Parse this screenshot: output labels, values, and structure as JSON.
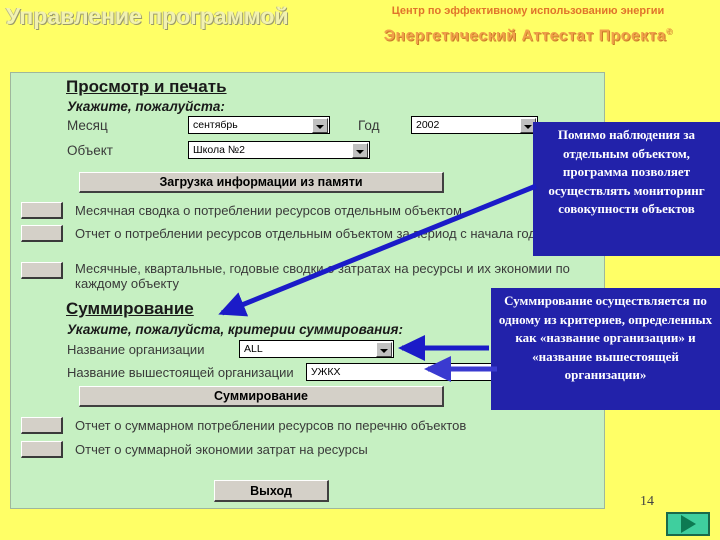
{
  "header": {
    "slide_title": "Управление программой",
    "subtitle": "Центр по эффективному использованию энергии",
    "main_title": "Энергетический Аттестат Проекта",
    "copyright_mark": "©"
  },
  "view_section": {
    "title": "Просмотр и печать",
    "instruction": "Укажите, пожалуйста:",
    "month_label": "Месяц",
    "month_value": "сентябрь",
    "year_label": "Год",
    "year_value": "2002",
    "object_label": "Объект",
    "object_value": "Школа №2",
    "load_button": "Загрузка информации из памяти",
    "reports": [
      "Месячная сводка о потреблении ресурсов отдельным объектом",
      "Отчет о потреблении ресурсов отдельным объектом за период с начала года",
      "Месячные, квартальные, годовые сводки о затратах на ресурсы и их экономии по каждому объекту"
    ]
  },
  "sum_section": {
    "title": "Суммирование",
    "instruction": "Укажите, пожалуйста, критерии суммирования:",
    "org_label": "Название организации",
    "org_value": "ALL",
    "parent_org_label": "Название вышестоящей организации",
    "parent_org_value": "УЖКХ",
    "sum_button": "Суммирование",
    "reports": [
      "Отчет о суммарном потреблении ресурсов по перечню объектов",
      "Отчет о суммарной экономии затрат на ресурсы"
    ],
    "exit_button": "Выход"
  },
  "callouts": {
    "monitoring": "Помимо наблюдения за отдельным объектом, программа позволяет осуществлять мониторинг совокупности объектов",
    "summation": "Суммирование осуществляется по одному из критериев, определенных как «название организации» и «название вышестоящей организации»"
  },
  "footer": {
    "page_number": "14",
    "next_icon": "play-triangle-icon"
  },
  "colors": {
    "background": "#ffff66",
    "panel": "#c6f0c2",
    "callout": "#2222aa",
    "arrow": "#1b1bc8",
    "accent_orange": "#f0a04a",
    "nav_button": "#3fcf9e"
  }
}
